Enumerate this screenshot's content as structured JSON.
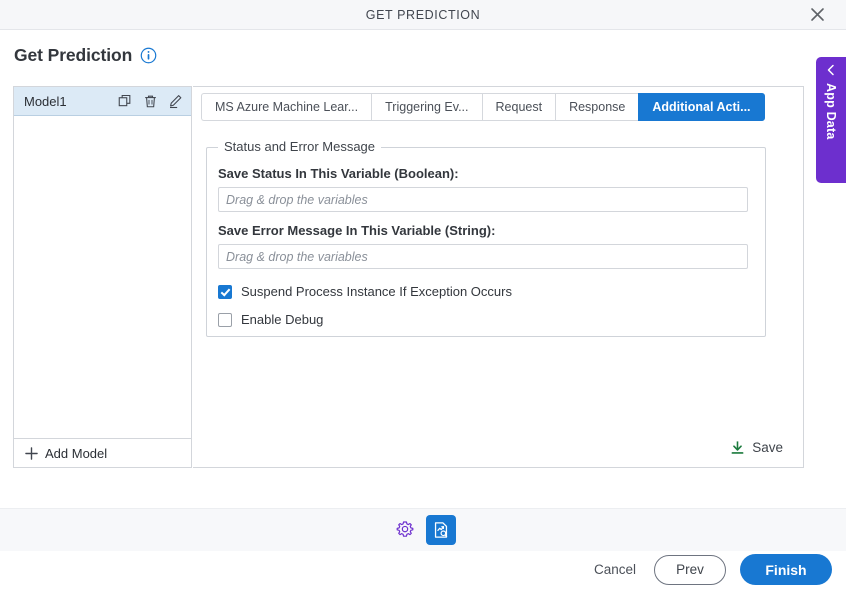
{
  "window": {
    "title": "GET PREDICTION",
    "close_icon": "close-icon"
  },
  "page": {
    "title": "Get Prediction",
    "info_icon": "info-icon"
  },
  "model_panel": {
    "rows": [
      {
        "label": "Model1",
        "icons": [
          "copy-icon",
          "delete-icon",
          "edit-icon"
        ]
      }
    ],
    "add_model_label": "Add Model",
    "add_icon": "plus-icon"
  },
  "tabs": [
    {
      "label": "MS Azure Machine Lear...",
      "active": false
    },
    {
      "label": "Triggering Ev...",
      "active": false
    },
    {
      "label": "Request",
      "active": false
    },
    {
      "label": "Response",
      "active": false
    },
    {
      "label": "Additional Acti...",
      "active": true
    }
  ],
  "form": {
    "legend": "Status and Error Message",
    "status_field": {
      "label": "Save Status In This Variable (Boolean):",
      "value": "",
      "placeholder": "Drag & drop the variables"
    },
    "error_field": {
      "label": "Save Error Message In This Variable (String):",
      "value": "",
      "placeholder": "Drag & drop the variables"
    },
    "suspend_checkbox": {
      "label": "Suspend Process Instance If Exception Occurs",
      "checked": true
    },
    "debug_checkbox": {
      "label": "Enable Debug",
      "checked": false
    }
  },
  "save": {
    "label": "Save",
    "icon": "download-icon"
  },
  "app_data": {
    "label": "App Data",
    "chevron_icon": "chevron-left-icon"
  },
  "footer": {
    "icons": [
      {
        "name": "gear-icon",
        "active": false
      },
      {
        "name": "prediction-report-icon",
        "active": true
      }
    ],
    "cancel_label": "Cancel",
    "prev_label": "Prev",
    "finish_label": "Finish"
  },
  "colors": {
    "accent_blue": "#1878d2",
    "app_data_purple": "#6d2fce",
    "save_green": "#1a7a3c",
    "gear_purple": "#6d2fce",
    "selected_row": "#dceaf6"
  }
}
